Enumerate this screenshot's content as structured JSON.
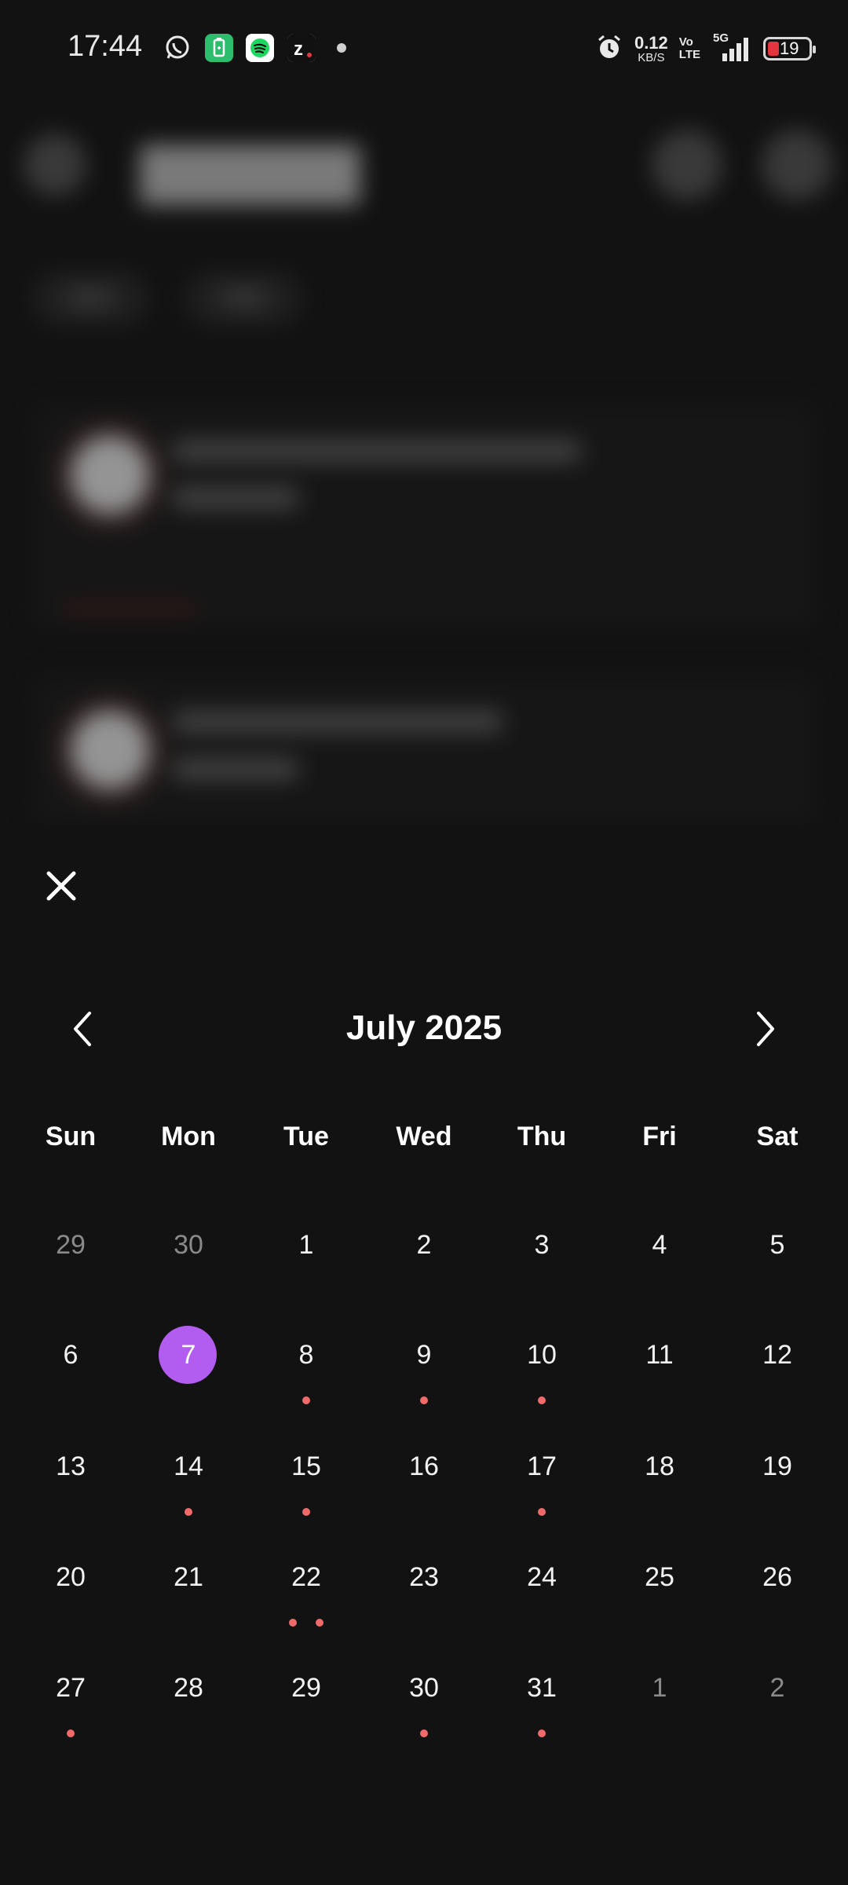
{
  "status_bar": {
    "time": "17:44",
    "notification_icons": [
      "whatsapp-icon",
      "battery-saver-icon",
      "spotify-icon",
      "zomato-icon",
      "more-dot-icon"
    ],
    "alarm_icon": "alarm-icon",
    "net_speed_value": "0.12",
    "net_speed_unit": "KB/S",
    "volte_top": "Vo",
    "volte_bottom": "LTE",
    "network_label": "5G",
    "battery_level": "19",
    "battery_color": "#e3343f"
  },
  "calendar": {
    "close_icon": "close-icon",
    "prev_icon": "chevron-left-icon",
    "next_icon": "chevron-right-icon",
    "month_title": "July 2025",
    "weekdays": [
      "Sun",
      "Mon",
      "Tue",
      "Wed",
      "Thu",
      "Fri",
      "Sat"
    ],
    "selected_color": "#b25cf0",
    "event_dot_color": "#f06a6a",
    "weeks": [
      [
        {
          "d": "29",
          "other": true,
          "dots": 0
        },
        {
          "d": "30",
          "other": true,
          "dots": 0
        },
        {
          "d": "1",
          "dots": 0
        },
        {
          "d": "2",
          "dots": 0
        },
        {
          "d": "3",
          "dots": 0
        },
        {
          "d": "4",
          "dots": 0
        },
        {
          "d": "5",
          "dots": 0
        }
      ],
      [
        {
          "d": "6",
          "dots": 0
        },
        {
          "d": "7",
          "selected": true,
          "dots": 0
        },
        {
          "d": "8",
          "dots": 1
        },
        {
          "d": "9",
          "dots": 1
        },
        {
          "d": "10",
          "dots": 1
        },
        {
          "d": "11",
          "dots": 0
        },
        {
          "d": "12",
          "dots": 0
        }
      ],
      [
        {
          "d": "13",
          "dots": 0
        },
        {
          "d": "14",
          "dots": 1
        },
        {
          "d": "15",
          "dots": 1
        },
        {
          "d": "16",
          "dots": 0
        },
        {
          "d": "17",
          "dots": 1
        },
        {
          "d": "18",
          "dots": 0
        },
        {
          "d": "19",
          "dots": 0
        }
      ],
      [
        {
          "d": "20",
          "dots": 0
        },
        {
          "d": "21",
          "dots": 0
        },
        {
          "d": "22",
          "dots": 2
        },
        {
          "d": "23",
          "dots": 0
        },
        {
          "d": "24",
          "dots": 0
        },
        {
          "d": "25",
          "dots": 0
        },
        {
          "d": "26",
          "dots": 0
        }
      ],
      [
        {
          "d": "27",
          "dots": 1
        },
        {
          "d": "28",
          "dots": 0
        },
        {
          "d": "29",
          "dots": 0
        },
        {
          "d": "30",
          "dots": 1
        },
        {
          "d": "31",
          "dots": 1
        },
        {
          "d": "1",
          "other": true,
          "dots": 0
        },
        {
          "d": "2",
          "other": true,
          "dots": 0
        }
      ]
    ]
  }
}
